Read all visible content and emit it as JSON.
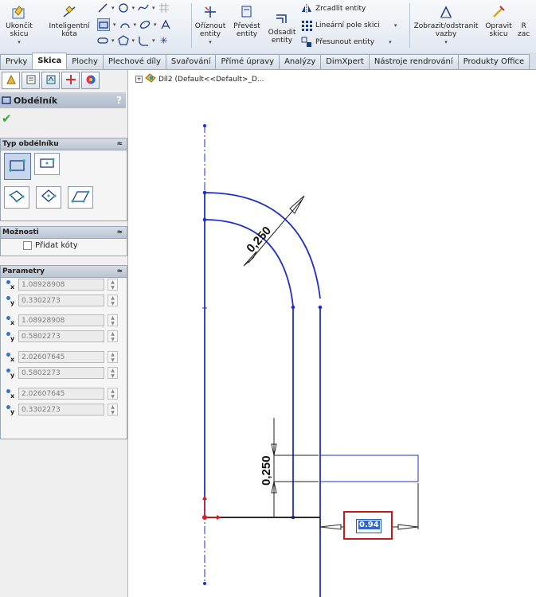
{
  "ribbon": {
    "exit_sketch": "Ukončit\nskicu",
    "smart_dim": "Inteligentní\nkóta",
    "trim": "Oříznout\nentity",
    "convert": "Převést\nentity",
    "offset": "Odsadit\nentity",
    "mirror": "Zrcadlit entity",
    "linear_pattern": "Lineární pole skici",
    "move": "Přesunout entity",
    "display_relations": "Zobrazit/odstranit\nvazby",
    "repair": "Opravit\nskicu",
    "quick": "R\nzac"
  },
  "tabs": [
    "Prvky",
    "Skica",
    "Plochy",
    "Plechové díly",
    "Svařování",
    "Přímé úpravy",
    "Analýzy",
    "DimXpert",
    "Nástroje rendrování",
    "Produkty Office"
  ],
  "active_tab": "Skica",
  "panel": {
    "title": "Obdélník",
    "help": "?",
    "rect_type_header": "Typ obdélníku",
    "options_header": "Možnosti",
    "add_dims_label": "Přidat kóty",
    "params_header": "Parametry",
    "params": [
      {
        "axis": "x",
        "value": "1.08928908"
      },
      {
        "axis": "y",
        "value": "0.3302273"
      },
      {
        "axis": "x",
        "value": "1.08928908"
      },
      {
        "axis": "y",
        "value": "0.5802273"
      },
      {
        "axis": "x",
        "value": "2.02607645"
      },
      {
        "axis": "y",
        "value": "0.5802273"
      },
      {
        "axis": "x",
        "value": "2.02607645"
      },
      {
        "axis": "y",
        "value": "0.3302273"
      }
    ]
  },
  "tree": {
    "label": "Díl2  (Default<<Default>_D..."
  },
  "dimensions": {
    "radial": "0,250",
    "vertical": "0,250",
    "input_value": "0.94"
  },
  "colors": {
    "sketch": "#1f2fc7",
    "highlight": "#c81e1e",
    "origin": "#d02020"
  }
}
